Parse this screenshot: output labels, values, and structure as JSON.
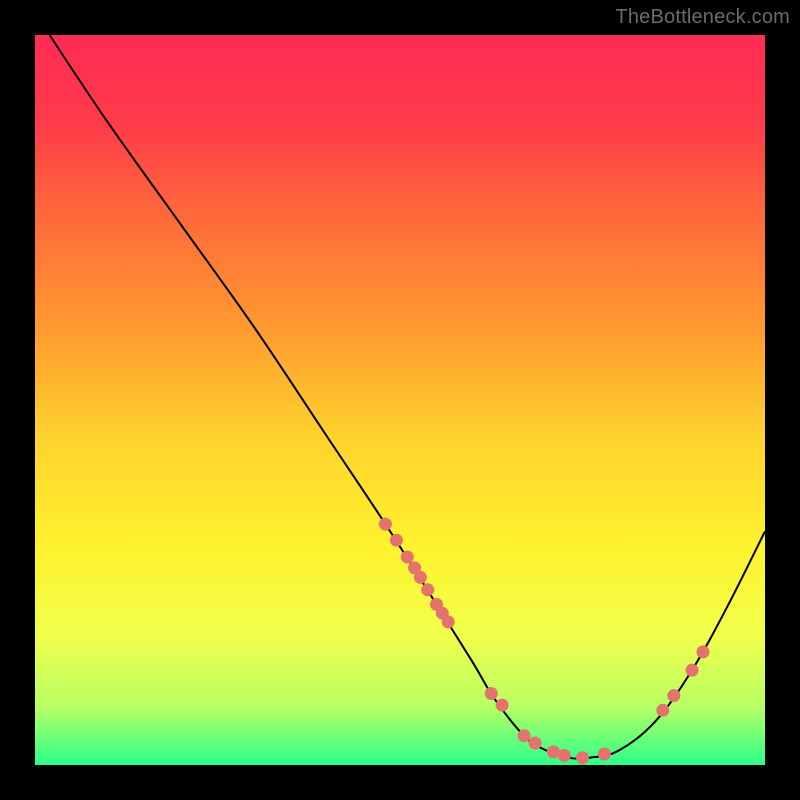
{
  "attribution": "TheBottleneck.com",
  "gradient": {
    "stops": [
      {
        "offset": "0%",
        "color": "#ff2b54"
      },
      {
        "offset": "12%",
        "color": "#ff3b4a"
      },
      {
        "offset": "25%",
        "color": "#ff6a3a"
      },
      {
        "offset": "40%",
        "color": "#ff9a30"
      },
      {
        "offset": "55%",
        "color": "#ffd22e"
      },
      {
        "offset": "70%",
        "color": "#fff22e"
      },
      {
        "offset": "82%",
        "color": "#f2ff4a"
      },
      {
        "offset": "92%",
        "color": "#b8ff64"
      },
      {
        "offset": "100%",
        "color": "#2bff8a"
      }
    ]
  },
  "chart_data": {
    "type": "line",
    "title": "",
    "xlabel": "",
    "ylabel": "",
    "xlim": [
      0,
      100
    ],
    "ylim": [
      0,
      100
    ],
    "series": [
      {
        "name": "bottleneck-curve",
        "x": [
          2,
          10,
          20,
          30,
          40,
          48,
          55,
          60,
          63,
          67,
          70,
          73,
          76,
          80,
          85,
          90,
          95,
          100
        ],
        "y": [
          100,
          88,
          74,
          60,
          45,
          33,
          22,
          14,
          9,
          4,
          2,
          1,
          1,
          2,
          6,
          13,
          22,
          32
        ]
      }
    ],
    "markers": {
      "name": "highlight-dots",
      "x": [
        48.0,
        49.5,
        51.0,
        52.0,
        52.8,
        53.8,
        55.0,
        55.8,
        56.6,
        62.5,
        64.0,
        67.0,
        68.5,
        71.0,
        72.5,
        75.0,
        78.0,
        86.0,
        87.5,
        90.0,
        91.5
      ],
      "y": [
        33.0,
        30.8,
        28.5,
        27.0,
        25.7,
        24.0,
        22.0,
        20.8,
        19.6,
        9.8,
        8.2,
        4.0,
        3.0,
        1.8,
        1.3,
        1.0,
        1.5,
        7.5,
        9.5,
        13.0,
        15.5
      ]
    }
  }
}
